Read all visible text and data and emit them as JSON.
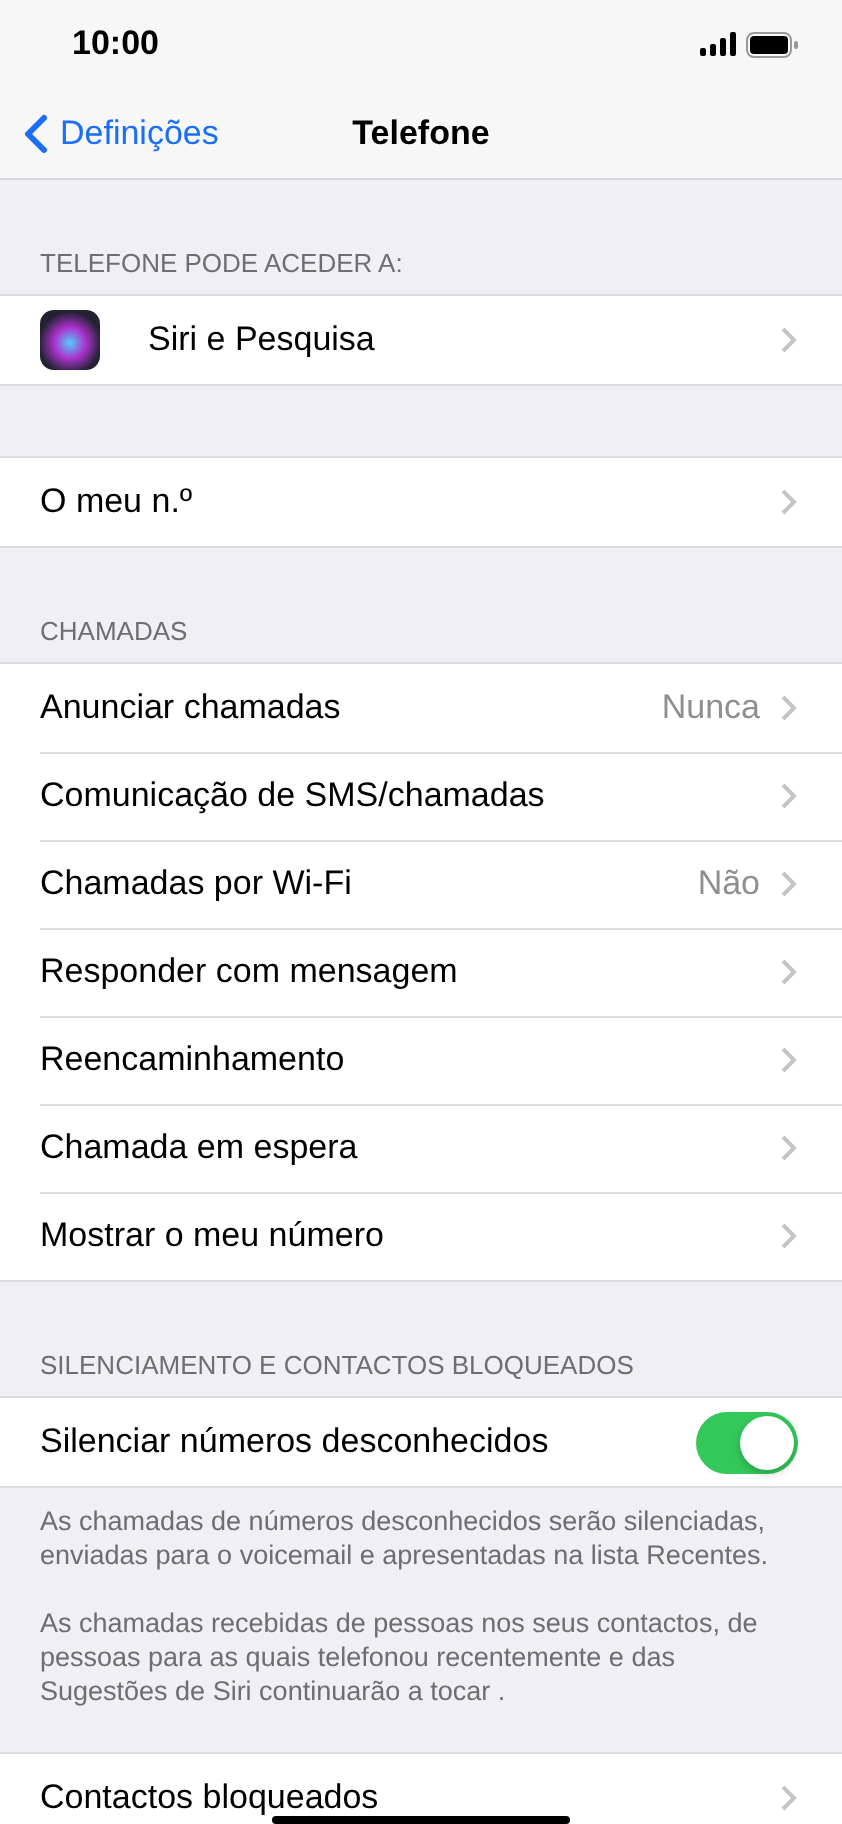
{
  "status_bar": {
    "time": "10:00"
  },
  "nav": {
    "back": "Definições",
    "title": "Telefone"
  },
  "sections": [
    {
      "header": "TELEFONE PODE ACEDER A:",
      "rows": [
        {
          "kind": "app",
          "label": "Siri e Pesquisa"
        }
      ]
    },
    {
      "rows": [
        {
          "kind": "link",
          "label": "O meu n.º"
        }
      ]
    },
    {
      "header": "CHAMADAS",
      "rows": [
        {
          "kind": "link",
          "label": "Anunciar chamadas",
          "value": "Nunca"
        },
        {
          "kind": "link",
          "label": "Comunicação de SMS/chamadas"
        },
        {
          "kind": "link",
          "label": "Chamadas por Wi-Fi",
          "value": "Não"
        },
        {
          "kind": "link",
          "label": "Responder com mensagem"
        },
        {
          "kind": "link",
          "label": "Reencaminhamento"
        },
        {
          "kind": "link",
          "label": "Chamada em espera"
        },
        {
          "kind": "link",
          "label": "Mostrar o meu número"
        }
      ]
    },
    {
      "header": "SILENCIAMENTO E CONTACTOS BLOQUEADOS",
      "rows": [
        {
          "kind": "toggle",
          "label": "Silenciar números desconhecidos",
          "on": true
        }
      ],
      "footer": [
        "As chamadas de números desconhecidos serão silenciadas, enviadas para o voicemail e apresentadas na lista Recentes.",
        "As chamadas recebidas de pessoas nos seus contactos, de pessoas para as quais telefonou recentemente e das Sugestões de Siri continuarão a tocar ."
      ]
    },
    {
      "rows": [
        {
          "kind": "link",
          "label": "Contactos bloqueados"
        }
      ]
    }
  ]
}
